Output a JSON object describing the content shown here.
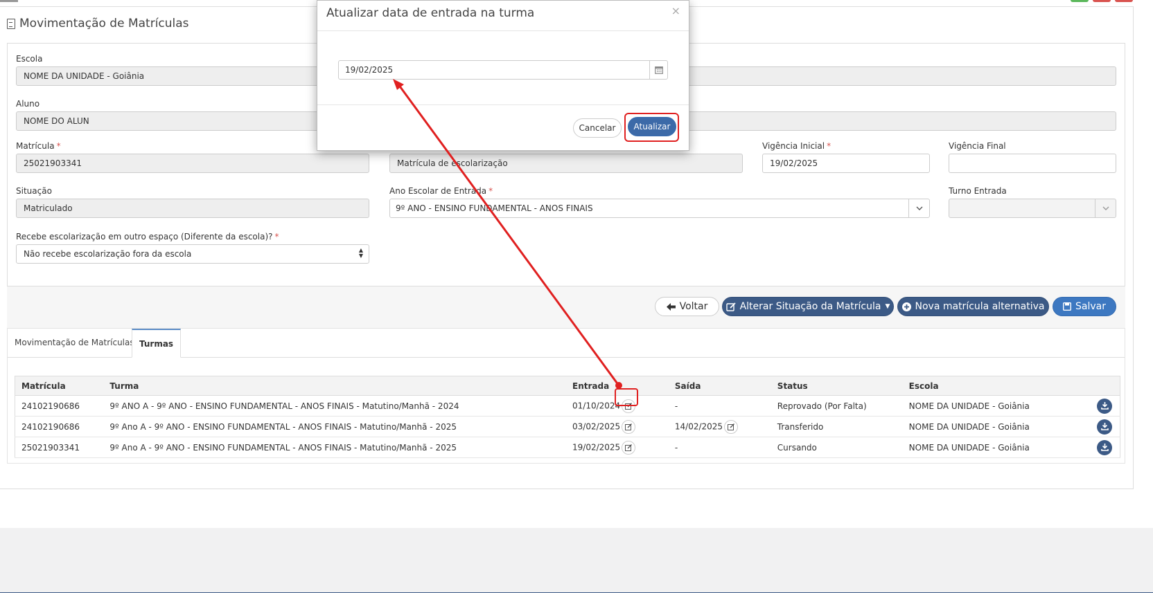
{
  "page": {
    "title": "Movimentação de Matrículas"
  },
  "form": {
    "escola": {
      "label": "Escola",
      "value": "NOME DA UNIDADE - Goiânia"
    },
    "aluno": {
      "label": "Aluno",
      "value": "NOME DO ALUN"
    },
    "matricula": {
      "label": "Matrícula",
      "value": "25021903341"
    },
    "tipo_matricula": {
      "value": "Matrícula de escolarização"
    },
    "vigencia_inicial": {
      "label": "Vigência Inicial",
      "value": "19/02/2025"
    },
    "vigencia_final": {
      "label": "Vigência Final",
      "value": ""
    },
    "situacao": {
      "label": "Situação",
      "value": "Matriculado"
    },
    "ano_escolar": {
      "label": "Ano Escolar de Entrada",
      "value": "9º ANO - ENSINO FUNDAMENTAL - ANOS FINAIS"
    },
    "turno_entrada": {
      "label": "Turno Entrada",
      "value": ""
    },
    "recebe_escolarizacao": {
      "label": "Recebe escolarização em outro espaço (Diferente da escola)?",
      "value": "Não recebe escolarização fora da escola"
    },
    "required_mark": "*"
  },
  "actions": {
    "voltar": "Voltar",
    "alterar_situacao": "Alterar Situação da Matrícula",
    "nova_matricula": "Nova matrícula alternativa",
    "salvar": "Salvar"
  },
  "tabs": [
    {
      "label": "Movimentação de Matrículas",
      "active": false
    },
    {
      "label": "Turmas",
      "active": true
    }
  ],
  "table": {
    "columns": [
      "Matrícula",
      "Turma",
      "Entrada",
      "Saída",
      "Status",
      "Escola"
    ],
    "rows": [
      {
        "matricula": "24102190686",
        "turma": "9º ANO A - 9º ANO - ENSINO FUNDAMENTAL - ANOS FINAIS - Matutino/Manhã - 2024",
        "entrada": "01/10/2024",
        "saida": "-",
        "status": "Reprovado (Por Falta)",
        "escola": "NOME DA UNIDADE - Goiânia"
      },
      {
        "matricula": "24102190686",
        "turma": "9º Ano A - 9º ANO - ENSINO FUNDAMENTAL - ANOS FINAIS - Matutino/Manhã - 2025",
        "entrada": "03/02/2025",
        "saida": "14/02/2025",
        "status": "Transferido",
        "escola": "NOME DA UNIDADE - Goiânia"
      },
      {
        "matricula": "25021903341",
        "turma": "9º Ano A - 9º ANO - ENSINO FUNDAMENTAL - ANOS FINAIS - Matutino/Manhã - 2025",
        "entrada": "19/02/2025",
        "saida": "-",
        "status": "Cursando",
        "escola": "NOME DA UNIDADE - Goiânia"
      }
    ]
  },
  "modal": {
    "title": "Atualizar data de entrada na turma",
    "close": "×",
    "date_value": "19/02/2025",
    "cancel": "Cancelar",
    "submit": "Atualizar"
  },
  "colors": {
    "primary_dark": "#3c5a86",
    "primary_blue": "#3d78c1",
    "highlight_red": "#e02020",
    "required": "#d9534f"
  },
  "icons": {
    "page_title": "document-icon",
    "voltar": "arrow-left-icon",
    "alterar": "edit-icon",
    "nova": "plus-circle-icon",
    "salvar": "floppy-icon",
    "entrada_edit": "edit-icon",
    "download": "download-icon",
    "calendar": "calendar-icon"
  }
}
